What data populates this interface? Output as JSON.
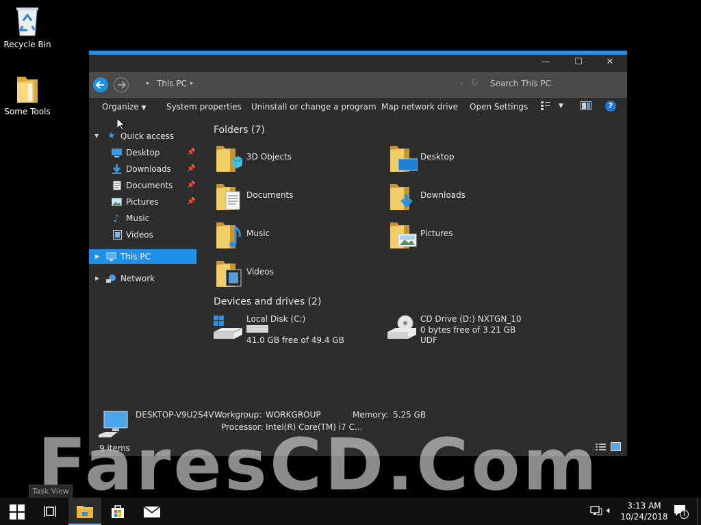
{
  "desktop": {
    "icons": [
      {
        "label": "Recycle Bin",
        "icon": "recycle-bin-icon"
      },
      {
        "label": "Some Tools",
        "icon": "folder-icon"
      }
    ]
  },
  "window": {
    "title_buttons": {
      "minimize": "—",
      "maximize": "☐",
      "close": "✕"
    },
    "address": {
      "separator": "▸",
      "location": "This PC",
      "chevron": "▸"
    },
    "search": {
      "placeholder": "Search This PC"
    },
    "commands": {
      "organize": "Organize",
      "system_properties": "System properties",
      "uninstall": "Uninstall or change a program",
      "map_drive": "Map network drive",
      "open_settings": "Open Settings",
      "help": "?"
    },
    "nav": {
      "quick_access": "Quick access",
      "items": [
        {
          "label": "Desktop",
          "pinned": true
        },
        {
          "label": "Downloads",
          "pinned": true
        },
        {
          "label": "Documents",
          "pinned": true
        },
        {
          "label": "Pictures",
          "pinned": true
        },
        {
          "label": "Music",
          "pinned": false
        },
        {
          "label": "Videos",
          "pinned": false
        }
      ],
      "this_pc": "This PC",
      "network": "Network"
    },
    "content": {
      "folders_header": "Folders (7)",
      "folders": [
        {
          "label": "3D Objects",
          "icon": "3d-objects-folder-icon"
        },
        {
          "label": "Desktop",
          "icon": "desktop-folder-icon"
        },
        {
          "label": "Documents",
          "icon": "documents-folder-icon"
        },
        {
          "label": "Downloads",
          "icon": "downloads-folder-icon"
        },
        {
          "label": "Music",
          "icon": "music-folder-icon"
        },
        {
          "label": "Pictures",
          "icon": "pictures-folder-icon"
        },
        {
          "label": "Videos",
          "icon": "videos-folder-icon"
        }
      ],
      "devices_header": "Devices and drives (2)",
      "drives": [
        {
          "name": "Local Disk (C:)",
          "free": "41.0 GB free of 49.4 GB",
          "used_fraction": 0.17
        },
        {
          "name": "CD Drive (D:) NXTGN_10",
          "free": "0 bytes free of 3.21 GB",
          "fs": "UDF"
        }
      ]
    },
    "details": {
      "computer_name": "DESKTOP-V9U2S4V",
      "workgroup_label": "Workgroup:",
      "workgroup": "WORKGROUP",
      "memory_label": "Memory:",
      "memory": "5.25 GB",
      "processor_label": "Processor:",
      "processor": "Intel(R) Core(TM) i7 C..."
    },
    "status": {
      "items": "9 items"
    }
  },
  "watermark": "FaresCD.Com",
  "taskbar": {
    "tooltip": "Task View",
    "clock_time": "3:13 AM",
    "clock_date": "10/24/2018",
    "notification_count": "1"
  },
  "colors": {
    "accent": "#1e90e6",
    "window_bg": "#2d2d2d",
    "address_bg": "#4a4a4a",
    "desktop": "#000000"
  }
}
